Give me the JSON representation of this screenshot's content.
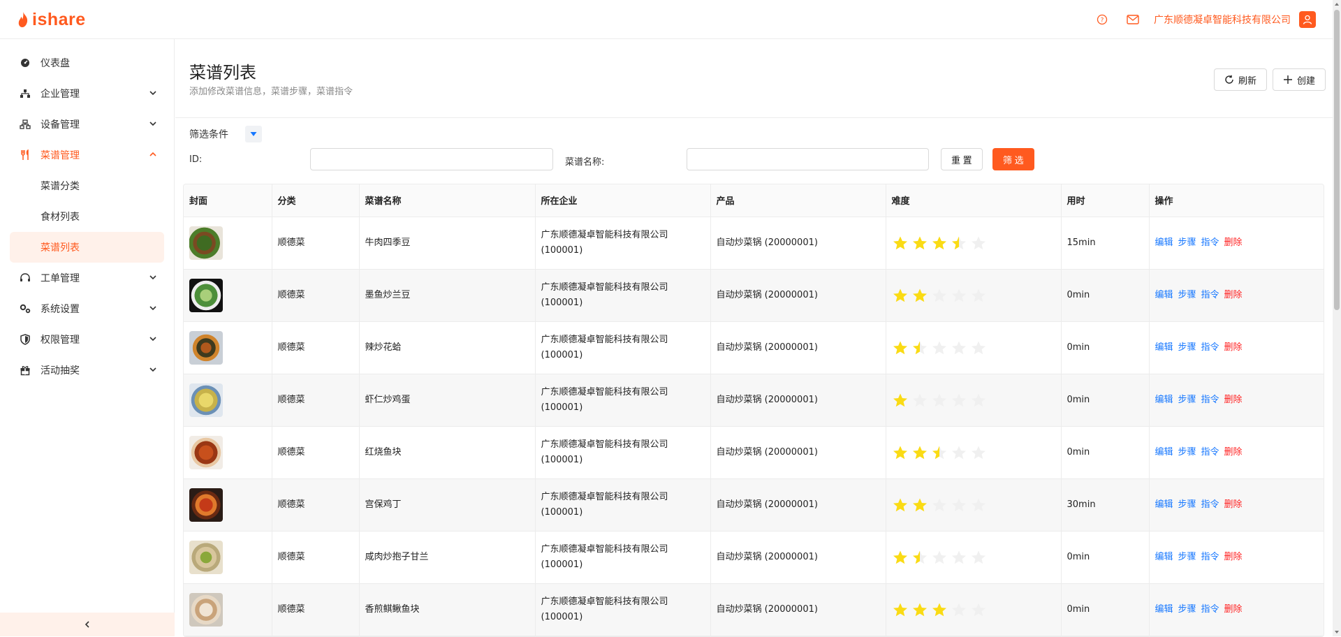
{
  "brand": {
    "logo_text": "ishare",
    "accent": "#ff5a1f"
  },
  "header": {
    "company": "广东顺德凝卓智能科技有限公司"
  },
  "sidebar": {
    "items": [
      {
        "label": "仪表盘",
        "icon": "dashboard-icon",
        "expandable": false
      },
      {
        "label": "企业管理",
        "icon": "org-icon",
        "expandable": true
      },
      {
        "label": "设备管理",
        "icon": "device-icon",
        "expandable": true
      },
      {
        "label": "菜谱管理",
        "icon": "fork-knife-icon",
        "expandable": true,
        "active": true,
        "children": [
          {
            "label": "菜谱分类"
          },
          {
            "label": "食材列表"
          },
          {
            "label": "菜谱列表",
            "selected": true
          }
        ]
      },
      {
        "label": "工单管理",
        "icon": "headset-icon",
        "expandable": true
      },
      {
        "label": "系统设置",
        "icon": "gears-icon",
        "expandable": true
      },
      {
        "label": "权限管理",
        "icon": "shield-icon",
        "expandable": true
      },
      {
        "label": "活动抽奖",
        "icon": "gift-icon",
        "expandable": true
      }
    ]
  },
  "page": {
    "title": "菜谱列表",
    "subtitle": "添加修改菜谱信息，菜谱步骤，菜谱指令",
    "refresh_label": "刷新",
    "create_label": "创建"
  },
  "filters": {
    "title": "筛选条件",
    "id_label": "ID:",
    "name_label": "菜谱名称:",
    "id_value": "",
    "name_value": "",
    "reset_label": "重 置",
    "filter_label": "筛 选"
  },
  "table": {
    "columns": [
      "封面",
      "分类",
      "菜谱名称",
      "所在企业",
      "产品",
      "难度",
      "用时",
      "操作"
    ],
    "ops": {
      "edit": "编辑",
      "steps": "步骤",
      "cmd": "指令",
      "del": "删除"
    },
    "rows": [
      {
        "category": "顺德菜",
        "name": "牛肉四季豆",
        "company": "广东顺德凝卓智能科技有限公司",
        "company_id": "(100001)",
        "product": "自动炒菜锅 (20000001)",
        "difficulty": 3.5,
        "time": "15min",
        "cover": "cover-beef-beans"
      },
      {
        "category": "顺德菜",
        "name": "墨鱼炒兰豆",
        "company": "广东顺德凝卓智能科技有限公司",
        "company_id": "(100001)",
        "product": "自动炒菜锅 (20000001)",
        "difficulty": 2,
        "time": "0min",
        "cover": "cover-squid-peas"
      },
      {
        "category": "顺德菜",
        "name": "辣炒花蛤",
        "company": "广东顺德凝卓智能科技有限公司",
        "company_id": "(100001)",
        "product": "自动炒菜锅 (20000001)",
        "difficulty": 1.5,
        "time": "0min",
        "cover": "cover-clams"
      },
      {
        "category": "顺德菜",
        "name": "虾仁炒鸡蛋",
        "company": "广东顺德凝卓智能科技有限公司",
        "company_id": "(100001)",
        "product": "自动炒菜锅 (20000001)",
        "difficulty": 1,
        "time": "0min",
        "cover": "cover-shrimp-egg"
      },
      {
        "category": "顺德菜",
        "name": "红烧鱼块",
        "company": "广东顺德凝卓智能科技有限公司",
        "company_id": "(100001)",
        "product": "自动炒菜锅 (20000001)",
        "difficulty": 2.5,
        "time": "0min",
        "cover": "cover-braised-fish"
      },
      {
        "category": "顺德菜",
        "name": "宫保鸡丁",
        "company": "广东顺德凝卓智能科技有限公司",
        "company_id": "(100001)",
        "product": "自动炒菜锅 (20000001)",
        "difficulty": 2,
        "time": "30min",
        "cover": "cover-kungpao"
      },
      {
        "category": "顺德菜",
        "name": "咸肉炒抱子甘兰",
        "company": "广东顺德凝卓智能科技有限公司",
        "company_id": "(100001)",
        "product": "自动炒菜锅 (20000001)",
        "difficulty": 1.5,
        "time": "0min",
        "cover": "cover-sprouts"
      },
      {
        "category": "顺德菜",
        "name": "香煎鲯鳅鱼块",
        "company": "广东顺德凝卓智能科技有限公司",
        "company_id": "(100001)",
        "product": "自动炒菜锅 (20000001)",
        "difficulty": 3,
        "time": "0min",
        "cover": "cover-fried-fish"
      }
    ]
  }
}
